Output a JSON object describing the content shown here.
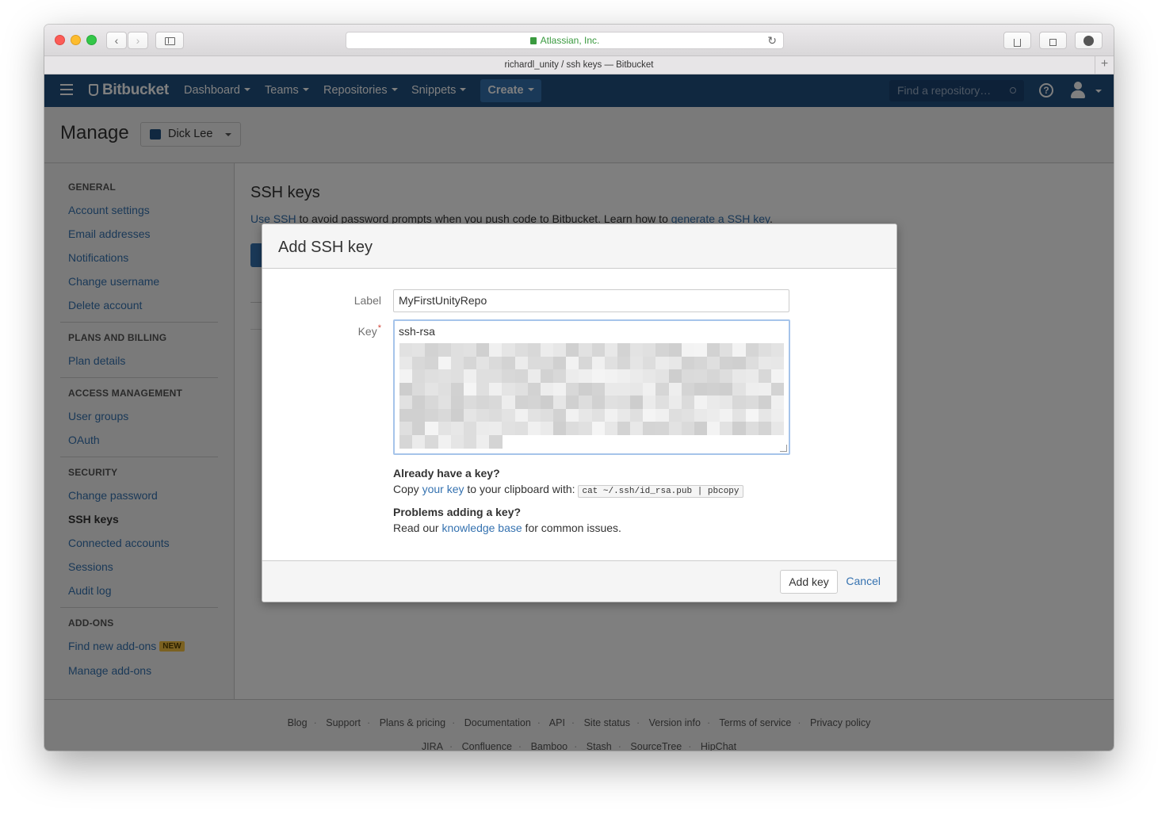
{
  "browser": {
    "url_text": "Atlassian, Inc.",
    "tab_title": "richardl_unity / ssh keys — Bitbucket",
    "back_glyph": "‹",
    "forward_glyph": "›",
    "new_tab_glyph": "+",
    "reload_glyph": "↻",
    "icons": [
      "back-icon",
      "forward-icon",
      "sidebar-icon",
      "lock-icon",
      "reload-icon",
      "share-icon",
      "tabs-icon",
      "download-icon"
    ]
  },
  "topnav": {
    "brand": "Bitbucket",
    "menu": [
      {
        "label": "Dashboard"
      },
      {
        "label": "Teams"
      },
      {
        "label": "Repositories"
      },
      {
        "label": "Snippets"
      }
    ],
    "create_label": "Create",
    "search_placeholder": "Find a repository…",
    "help_glyph": "?",
    "bg_color": "#205081"
  },
  "header": {
    "title": "Manage",
    "account": "Dick Lee"
  },
  "sidebar": {
    "general_title": "GENERAL",
    "general": [
      "Account settings",
      "Email addresses",
      "Notifications",
      "Change username",
      "Delete account"
    ],
    "billing_title": "PLANS AND BILLING",
    "billing": [
      "Plan details"
    ],
    "access_title": "ACCESS MANAGEMENT",
    "access": [
      "User groups",
      "OAuth"
    ],
    "security_title": "SECURITY",
    "security": [
      "Change password",
      "SSH keys",
      "Connected accounts",
      "Sessions",
      "Audit log"
    ],
    "addons_title": "ADD-ONS",
    "addons": [
      "Find new add-ons",
      "Manage add-ons"
    ],
    "new_badge": "NEW"
  },
  "main": {
    "title": "SSH keys",
    "intro_link1": "Use SSH",
    "intro_mid": " to avoid password prompts when you push code to Bitbucket. Learn how to ",
    "intro_link2": "generate a SSH key",
    "intro_end": "."
  },
  "dialog": {
    "title": "Add SSH key",
    "label_label": "Label",
    "label_value": "MyFirstUnityRepo",
    "key_label": "Key",
    "required_mark": "*",
    "key_value_visible": "ssh-rsa",
    "already_title": "Already have a key?",
    "copy_prefix": "Copy ",
    "copy_link": "your key",
    "copy_mid": " to your clipboard with: ",
    "copy_cmd": "cat ~/.ssh/id_rsa.pub | pbcopy",
    "problems_title": "Problems adding a key?",
    "read_prefix": "Read our ",
    "read_link": "knowledge base",
    "read_suffix": " for common issues.",
    "add_button": "Add key",
    "cancel_button": "Cancel"
  },
  "footer": {
    "row1": [
      "Blog",
      "Support",
      "Plans & pricing",
      "Documentation",
      "API",
      "Site status",
      "Version info",
      "Terms of service",
      "Privacy policy"
    ],
    "row2": [
      "JIRA",
      "Confluence",
      "Bamboo",
      "Stash",
      "SourceTree",
      "HipChat"
    ],
    "separator": "·"
  },
  "colors": {
    "accent": "#3572b0",
    "badge": "#f6c342",
    "required": "#d04437"
  }
}
